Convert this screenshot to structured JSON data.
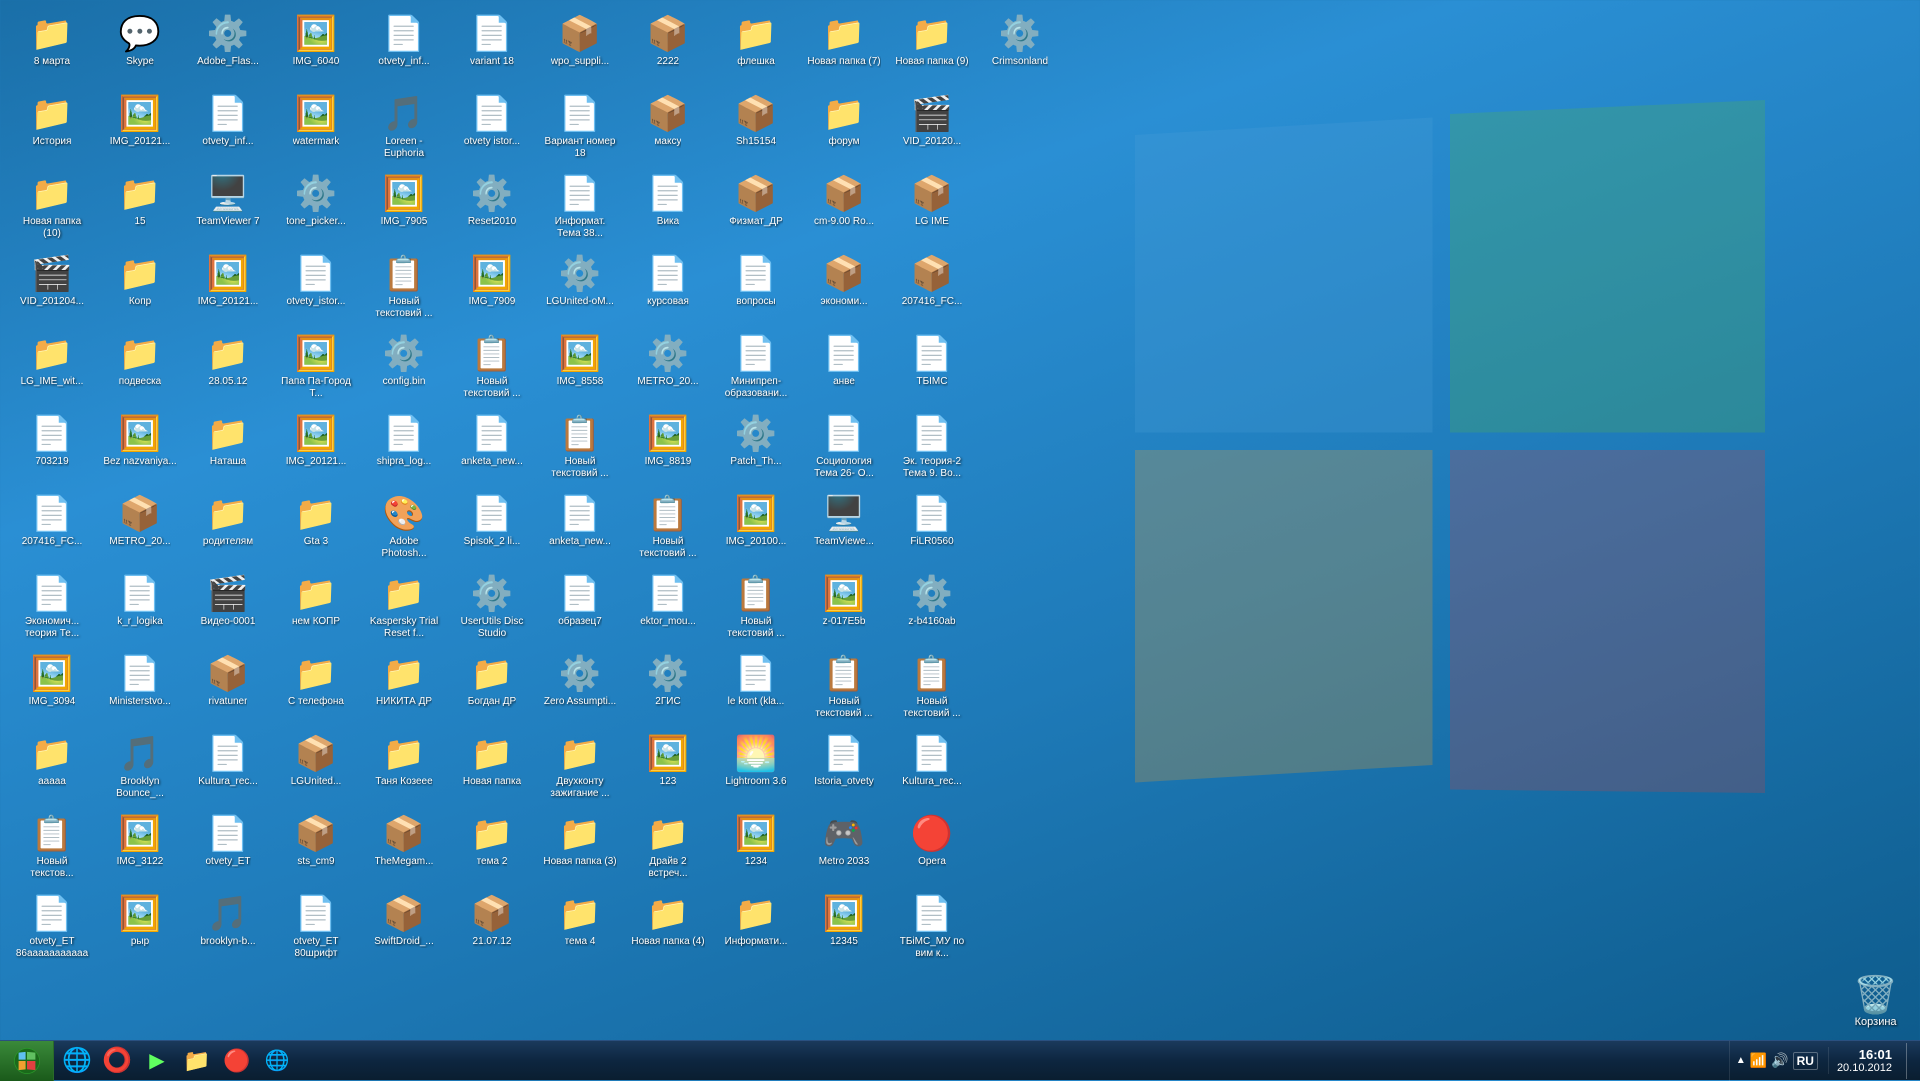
{
  "desktop": {
    "icons": [
      {
        "id": "8marta",
        "label": "8 марта",
        "type": "folder",
        "col": 1
      },
      {
        "id": "istoriya",
        "label": "История",
        "type": "folder",
        "col": 1
      },
      {
        "id": "novaya-papka-10",
        "label": "Новая папка (10)",
        "type": "folder",
        "col": 1
      },
      {
        "id": "vid2012041",
        "label": "VID_201204...",
        "type": "video",
        "col": 1
      },
      {
        "id": "lgime-with",
        "label": "LG_IME_wit...",
        "type": "folder",
        "col": 1
      },
      {
        "id": "703219",
        "label": "703219",
        "type": "docx",
        "col": 1
      },
      {
        "id": "207416-fc",
        "label": "207416_FC...",
        "type": "docx",
        "col": 1
      },
      {
        "id": "ekonomich",
        "label": "Экономич... теория Те...",
        "type": "docx",
        "col": 1
      },
      {
        "id": "img3094",
        "label": "IMG_3094",
        "type": "image",
        "col": 1
      },
      {
        "id": "aaaaa",
        "label": "ааааа",
        "type": "folder",
        "col": 1
      },
      {
        "id": "novyi-tekst",
        "label": "Новый текстов...",
        "type": "txt",
        "col": 1
      },
      {
        "id": "otvety-et",
        "label": "otvety_ET 86ааааааааааа",
        "type": "docx",
        "col": 1
      },
      {
        "id": "skype",
        "label": "Skype",
        "type": "skype",
        "col": 1
      },
      {
        "id": "img2012",
        "label": "IMG_20121...",
        "type": "image",
        "col": 1
      },
      {
        "id": "15",
        "label": "15",
        "type": "folder",
        "col": 2
      },
      {
        "id": "kopr",
        "label": "Копр",
        "type": "folder",
        "col": 2
      },
      {
        "id": "podveska",
        "label": "подвеска",
        "type": "folder",
        "col": 2
      },
      {
        "id": "bez-nazv",
        "label": "Bez nazvaniya...",
        "type": "image",
        "col": 2
      },
      {
        "id": "metro20",
        "label": "METRO_20...",
        "type": "zip",
        "col": 2
      },
      {
        "id": "kk-logika",
        "label": "k_r_logika",
        "type": "docx",
        "col": 2
      },
      {
        "id": "ministerstvo",
        "label": "Ministerstvo...",
        "type": "docx",
        "col": 2
      },
      {
        "id": "brooklyn-bounce",
        "label": "Brooklyn Bounce_...",
        "type": "mp3",
        "col": 2
      },
      {
        "id": "img3122",
        "label": "IMG_3122",
        "type": "image",
        "col": 2
      },
      {
        "id": "ryp",
        "label": "рыр",
        "type": "image",
        "col": 2
      },
      {
        "id": "adobe-flash",
        "label": "Adobe_Flas...",
        "type": "exe",
        "col": 2
      },
      {
        "id": "otvety-inf",
        "label": "otvety_inf...",
        "type": "docx",
        "col": 2
      },
      {
        "id": "teamviewer7",
        "label": "TeamViewer 7",
        "type": "teamviewer",
        "col": 2
      },
      {
        "id": "img20121b",
        "label": "IMG_20121...",
        "type": "image",
        "col": 2
      },
      {
        "id": "28-05-12",
        "label": "28.05.12",
        "type": "folder",
        "col": 3
      },
      {
        "id": "natasha",
        "label": "Наташа",
        "type": "folder",
        "col": 3
      },
      {
        "id": "roditelyam",
        "label": "родителям",
        "type": "folder",
        "col": 3
      },
      {
        "id": "video0001",
        "label": "Видео-0001",
        "type": "video",
        "col": 3
      },
      {
        "id": "rivatuner",
        "label": "rivatuner",
        "type": "zip",
        "col": 3
      },
      {
        "id": "kultura-rec",
        "label": "Kultura_rec...",
        "type": "docx",
        "col": 3
      },
      {
        "id": "otvety-et2",
        "label": "otvety_ET",
        "type": "docx",
        "col": 3
      },
      {
        "id": "brooklyn-b",
        "label": "brooklyn-b...",
        "type": "mp3",
        "col": 3
      },
      {
        "id": "img6040",
        "label": "IMG_6040",
        "type": "image",
        "col": 3
      },
      {
        "id": "watermark",
        "label": "watermark",
        "type": "image",
        "col": 3
      },
      {
        "id": "tone-picker",
        "label": "tone_picker...",
        "type": "exe",
        "col": 3
      },
      {
        "id": "otvety-istor",
        "label": "otvety_istor...",
        "type": "docx",
        "col": 3
      },
      {
        "id": "papa-pa",
        "label": "Папа Па-Город Т...",
        "type": "image",
        "col": 3
      },
      {
        "id": "img20121c",
        "label": "IMG_20121...",
        "type": "image",
        "col": 3
      },
      {
        "id": "gta3",
        "label": "Gta 3",
        "type": "folder",
        "col": 4
      },
      {
        "id": "nem-kopr",
        "label": "нем КОПР",
        "type": "folder",
        "col": 4
      },
      {
        "id": "s-telefona",
        "label": "С телефона",
        "type": "folder",
        "col": 4
      },
      {
        "id": "lgunited",
        "label": "LGUnited...",
        "type": "zip",
        "col": 4
      },
      {
        "id": "sts-cm9",
        "label": "sts_cm9",
        "type": "zip",
        "col": 4
      },
      {
        "id": "otvety-et80",
        "label": "otvety_ET 80шрифт",
        "type": "docx",
        "col": 4
      },
      {
        "id": "otvety-inf2",
        "label": "otvety_inf...",
        "type": "docx",
        "col": 4
      },
      {
        "id": "loreen-euph",
        "label": "Loreen - Euphoria",
        "type": "mp3",
        "col": 4
      },
      {
        "id": "img7905",
        "label": "IMG_7905",
        "type": "image",
        "col": 4
      },
      {
        "id": "novyi-tekst2",
        "label": "Новый текстовий ...",
        "type": "txt",
        "col": 4
      },
      {
        "id": "config-bin",
        "label": "config.bin",
        "type": "sys",
        "col": 4
      },
      {
        "id": "shipra-log",
        "label": "shipra_log...",
        "type": "docx",
        "col": 4
      },
      {
        "id": "adobe-ps",
        "label": "Adobe Photosh...",
        "type": "photoshop",
        "col": 4
      },
      {
        "id": "kaspersky",
        "label": "Kaspersky Trial Reset f...",
        "type": "folder",
        "col": 5
      },
      {
        "id": "nikita-dp",
        "label": "НИКИТА ДР",
        "type": "folder",
        "col": 5
      },
      {
        "id": "tanya-koz",
        "label": "Таня Козеее",
        "type": "folder",
        "col": 5
      },
      {
        "id": "themegam",
        "label": "TheMegam...",
        "type": "zip",
        "col": 5
      },
      {
        "id": "swiftdroid",
        "label": "SwiftDroid_...",
        "type": "zip",
        "col": 5
      },
      {
        "id": "variant18",
        "label": "variant 18",
        "type": "docx",
        "col": 5
      },
      {
        "id": "otvety-istor2",
        "label": "otvety istor...",
        "type": "docx",
        "col": 5
      },
      {
        "id": "reset2010",
        "label": "Reset2010",
        "type": "exe",
        "col": 5
      },
      {
        "id": "img7909",
        "label": "IMG_7909",
        "type": "image",
        "col": 5
      },
      {
        "id": "novyi-tekst3",
        "label": "Новый текстовий ...",
        "type": "txt",
        "col": 5
      },
      {
        "id": "anketa-new",
        "label": "anketa_new...",
        "type": "docx",
        "col": 5
      },
      {
        "id": "spisok-2",
        "label": "Spisok_2 li...",
        "type": "docx",
        "col": 5
      },
      {
        "id": "userutils-disc",
        "label": "UserUtils Disc Studio",
        "type": "exe",
        "col": 5
      },
      {
        "id": "bogdan-dp",
        "label": "Богдан ДР",
        "type": "folder",
        "col": 6
      },
      {
        "id": "novaya-papka",
        "label": "Новая папка",
        "type": "folder",
        "col": 6
      },
      {
        "id": "tema2",
        "label": "тема 2",
        "type": "folder",
        "col": 6
      },
      {
        "id": "21-07-12",
        "label": "21.07.12",
        "type": "zip",
        "col": 6
      },
      {
        "id": "wpo-suppli",
        "label": "wpo_suppli...",
        "type": "zip",
        "col": 6
      },
      {
        "id": "variant-nom18",
        "label": "Вариант номер 18",
        "type": "docx",
        "col": 6
      },
      {
        "id": "informat-tema38",
        "label": "Информат. Тема 38...",
        "type": "docx",
        "col": 6
      },
      {
        "id": "lgunited2",
        "label": "LGUnited-oM...",
        "type": "exe",
        "col": 6
      },
      {
        "id": "img8558",
        "label": "IMG_8558",
        "type": "image",
        "col": 6
      },
      {
        "id": "novyi-tekst4",
        "label": "Новый текстовий ...",
        "type": "txt",
        "col": 6
      },
      {
        "id": "anketa-new2",
        "label": "anketa_new...",
        "type": "docx",
        "col": 6
      },
      {
        "id": "obrazec7",
        "label": "образец7",
        "type": "docx",
        "col": 6
      },
      {
        "id": "zero-assump",
        "label": "Zero Assumpti...",
        "type": "exe",
        "col": 6
      },
      {
        "id": "dvuhkontu",
        "label": "Двухконту зажигание ...",
        "type": "folder",
        "col": 7
      },
      {
        "id": "novaya-papka3",
        "label": "Новая папка (3)",
        "type": "folder",
        "col": 7
      },
      {
        "id": "tema4",
        "label": "тема 4",
        "type": "folder",
        "col": 7
      },
      {
        "id": "2222",
        "label": "2222",
        "type": "zip",
        "col": 7
      },
      {
        "id": "maksy",
        "label": "максу",
        "type": "zip",
        "col": 7
      },
      {
        "id": "vika",
        "label": "Вика",
        "type": "docx",
        "col": 7
      },
      {
        "id": "kursovaya",
        "label": "курсовая",
        "type": "docx",
        "col": 7
      },
      {
        "id": "metro20b",
        "label": "METRO_20...",
        "type": "exe",
        "col": 7
      },
      {
        "id": "img8819",
        "label": "IMG_8819",
        "type": "image",
        "col": 7
      },
      {
        "id": "novyi-tekst5",
        "label": "Новый текстовий ...",
        "type": "txt",
        "col": 7
      },
      {
        "id": "ektor-mou",
        "label": "ektor_mou...",
        "type": "docx",
        "col": 7
      },
      {
        "id": "2gis",
        "label": "2ГИС",
        "type": "exe",
        "col": 7
      },
      {
        "id": "123",
        "label": "123",
        "type": "image",
        "col": 7
      },
      {
        "id": "draiv2",
        "label": "Драйв 2 встреч...",
        "type": "folder",
        "col": 8
      },
      {
        "id": "novaya-papka4",
        "label": "Новая папка (4)",
        "type": "folder",
        "col": 8
      },
      {
        "id": "fleshka",
        "label": "флешка",
        "type": "folder",
        "col": 8
      },
      {
        "id": "sh15154",
        "label": "Sh15154",
        "type": "zip",
        "col": 8
      },
      {
        "id": "fizmat-dp",
        "label": "Физмат_ДР",
        "type": "zip",
        "col": 8
      },
      {
        "id": "voprosy",
        "label": "вопросы",
        "type": "docx",
        "col": 8
      },
      {
        "id": "miniprep-obr",
        "label": "Минипреп- образовани...",
        "type": "docx",
        "col": 8
      },
      {
        "id": "patch-th",
        "label": "Patch_Th...",
        "type": "exe",
        "col": 8
      },
      {
        "id": "img20100",
        "label": "IMG_20100...",
        "type": "image",
        "col": 8
      },
      {
        "id": "novyi-tekst6",
        "label": "Новый текстовий ...",
        "type": "txt",
        "col": 8
      },
      {
        "id": "le-kont",
        "label": "le kont (kla...",
        "type": "docx",
        "col": 8
      },
      {
        "id": "lightroom38",
        "label": "Lightroom 3.6",
        "type": "lightroom",
        "col": 8
      },
      {
        "id": "1234",
        "label": "1234",
        "type": "image",
        "col": 8
      },
      {
        "id": "informati",
        "label": "Информати...",
        "type": "folder",
        "col": 9
      },
      {
        "id": "novaya-papka7",
        "label": "Новая папка (7)",
        "type": "folder",
        "col": 9
      },
      {
        "id": "forum",
        "label": "форум",
        "type": "folder",
        "col": 9
      },
      {
        "id": "cm9-rom",
        "label": "cm-9.00 Ro...",
        "type": "zip",
        "col": 9
      },
      {
        "id": "ekonom",
        "label": "экономи...",
        "type": "zip",
        "col": 9
      },
      {
        "id": "anve",
        "label": "анве",
        "type": "docx",
        "col": 9
      },
      {
        "id": "sotsiolog-tema",
        "label": "Социология Тема 26- О...",
        "type": "docx",
        "col": 9
      },
      {
        "id": "teamviewer2",
        "label": "TeamViewe...",
        "type": "teamviewer",
        "col": 9
      },
      {
        "id": "017e5b",
        "label": "z-017E5b",
        "type": "image",
        "col": 9
      },
      {
        "id": "novyi-tekst7",
        "label": "Новый текстовий ...",
        "type": "txt",
        "col": 9
      },
      {
        "id": "istoria-otvety",
        "label": "Istoria_otvety",
        "type": "docx",
        "col": 9
      },
      {
        "id": "metro2033",
        "label": "Metro 2033",
        "type": "metro",
        "col": 9
      },
      {
        "id": "12345",
        "label": "12345",
        "type": "image",
        "col": 9
      },
      {
        "id": "novaya-papka9",
        "label": "Новая папка (9)",
        "type": "folder",
        "col": 10
      },
      {
        "id": "vid201204b",
        "label": "VID_20120...",
        "type": "video",
        "col": 10
      },
      {
        "id": "lg-ime",
        "label": "LG IME",
        "type": "zip",
        "col": 10
      },
      {
        "id": "207416-fcb",
        "label": "207416_FC...",
        "type": "zip",
        "col": 10
      },
      {
        "id": "tbimc",
        "label": "ТБІМС",
        "type": "docx",
        "col": 10
      },
      {
        "id": "ek-teoria2",
        "label": "Эк. теория-2 Тема 9. Во...",
        "type": "docx",
        "col": 10
      },
      {
        "id": "filr0560",
        "label": "FiLR0560",
        "type": "docx",
        "col": 10
      },
      {
        "id": "z-b4160ab",
        "label": "z-b4160ab",
        "type": "exe",
        "col": 10
      },
      {
        "id": "novyi-tekst8",
        "label": "Новый текстовий ...",
        "type": "txt",
        "col": 10
      },
      {
        "id": "kultura-rec2",
        "label": "Kultura_rec...",
        "type": "docx",
        "col": 10
      },
      {
        "id": "opera",
        "label": "Opera",
        "type": "opera",
        "col": 10
      },
      {
        "id": "tbimc-mp",
        "label": "ТБіМС_МУ по вим к...",
        "type": "docx",
        "col": 10
      },
      {
        "id": "crimsonland",
        "label": "Crimsonland",
        "type": "exe",
        "col": 10
      }
    ]
  },
  "taskbar": {
    "start_label": "Start",
    "items": [
      {
        "id": "ie",
        "label": "Internet Explorer",
        "type": "ie"
      },
      {
        "id": "opera-task",
        "label": "Opera",
        "type": "opera"
      },
      {
        "id": "winamp",
        "label": "Winamp",
        "type": "winamp"
      },
      {
        "id": "explorer",
        "label": "Windows Explorer",
        "type": "explorer"
      },
      {
        "id": "opera2",
        "label": "Opera",
        "type": "opera2"
      },
      {
        "id": "ie2",
        "label": "Internet Explorer",
        "type": "ie2"
      }
    ],
    "tray": {
      "lang": "RU",
      "time": "16:01",
      "date": "20.10.2012"
    }
  },
  "recycle": {
    "label": "Корзина"
  }
}
